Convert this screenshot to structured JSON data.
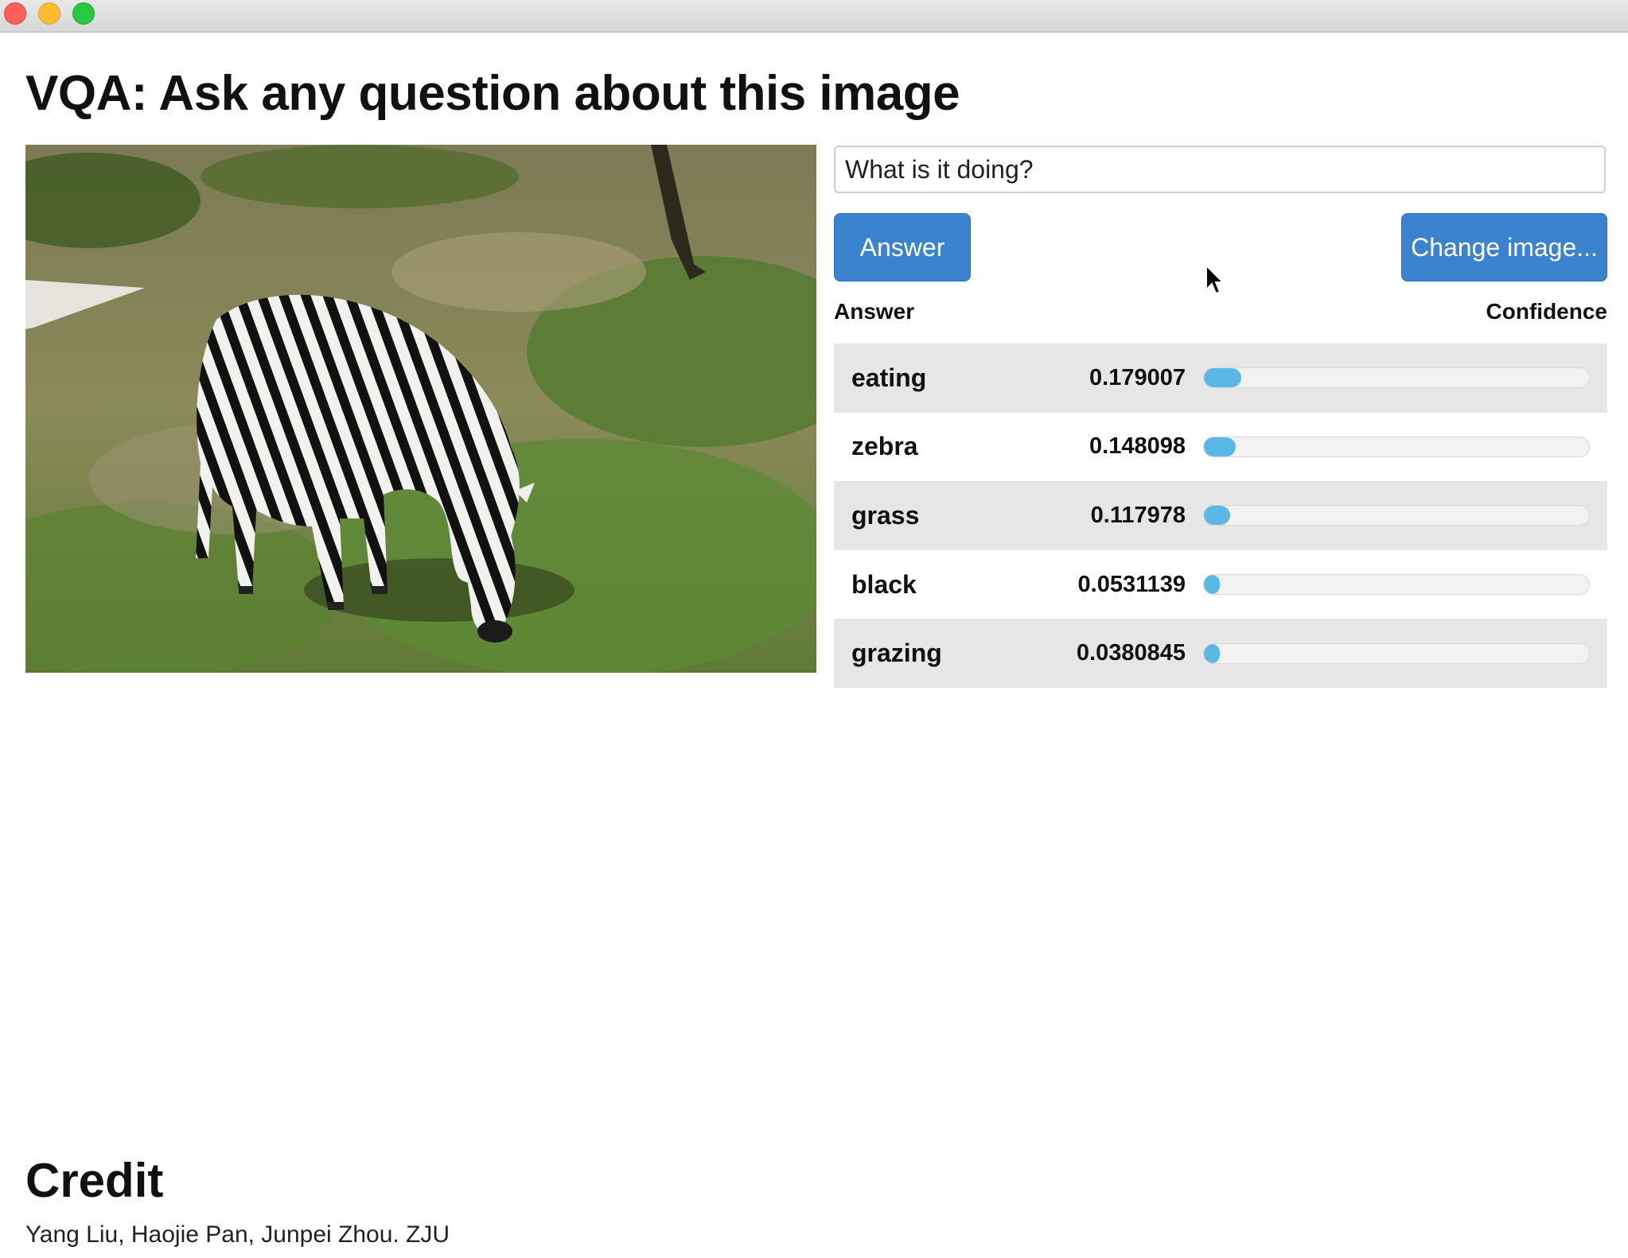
{
  "page": {
    "title": "VQA: Ask any question about this image"
  },
  "question": {
    "value": "What is it doing?"
  },
  "buttons": {
    "answer_label": "Answer",
    "change_label": "Change image..."
  },
  "table": {
    "col_answer": "Answer",
    "col_confidence": "Confidence",
    "rows": [
      {
        "answer": "eating",
        "confidence": "0.179007",
        "fill": 0.179007
      },
      {
        "answer": "zebra",
        "confidence": "0.148098",
        "fill": 0.148098
      },
      {
        "answer": "grass",
        "confidence": "0.117978",
        "fill": 0.117978
      },
      {
        "answer": "black",
        "confidence": "0.0531139",
        "fill": 0.0531139
      },
      {
        "answer": "grazing",
        "confidence": "0.0380845",
        "fill": 0.0380845
      }
    ]
  },
  "credit": {
    "title": "Credit",
    "text": "Yang Liu, Haojie Pan, Junpei Zhou. ZJU"
  },
  "colors": {
    "button": "#3b82cf",
    "bar_fill": "#5bb8e6",
    "row_shade": "#e6e6e6"
  }
}
